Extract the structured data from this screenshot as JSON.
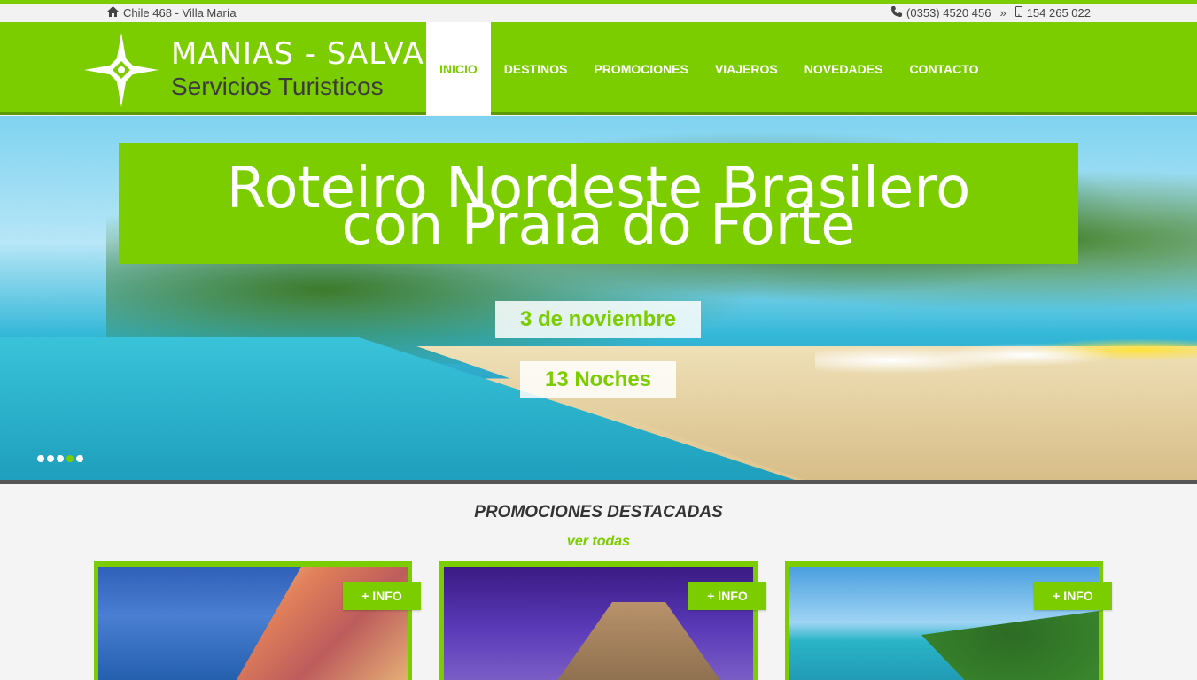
{
  "topbar": {
    "address": "Chile 468 - Villa María",
    "phone": "(0353) 4520 456",
    "separator": "»",
    "mobile": "154 265 022",
    "icons": [
      "home-icon",
      "phone-icon",
      "double-chevron-right-icon",
      "mobile-icon"
    ]
  },
  "logo": {
    "line1": "MANIAS - SALVAI",
    "line2": "Servicios Turisticos"
  },
  "nav": {
    "items": [
      {
        "label": "INICIO",
        "active": true
      },
      {
        "label": "DESTINOS",
        "active": false
      },
      {
        "label": "PROMOCIONES",
        "active": false
      },
      {
        "label": "VIAJEROS",
        "active": false
      },
      {
        "label": "NOVEDADES",
        "active": false
      },
      {
        "label": "CONTACTO",
        "active": false
      }
    ]
  },
  "hero": {
    "title_line1": "Roteiro Nordeste Brasilero",
    "title_line2": "con Praia do Forte",
    "date": "3 de noviembre",
    "nights": "13 Noches",
    "slides_count": 5,
    "active_slide": 4
  },
  "promos": {
    "heading": "PROMOCIONES DESTACADAS",
    "view_all": "ver todas",
    "cards": [
      {
        "button": "+ INFO"
      },
      {
        "button": "+ INFO"
      },
      {
        "button": "+ INFO"
      }
    ]
  },
  "colors": {
    "brand_green": "#7ccd00",
    "dark_text": "#333333"
  }
}
